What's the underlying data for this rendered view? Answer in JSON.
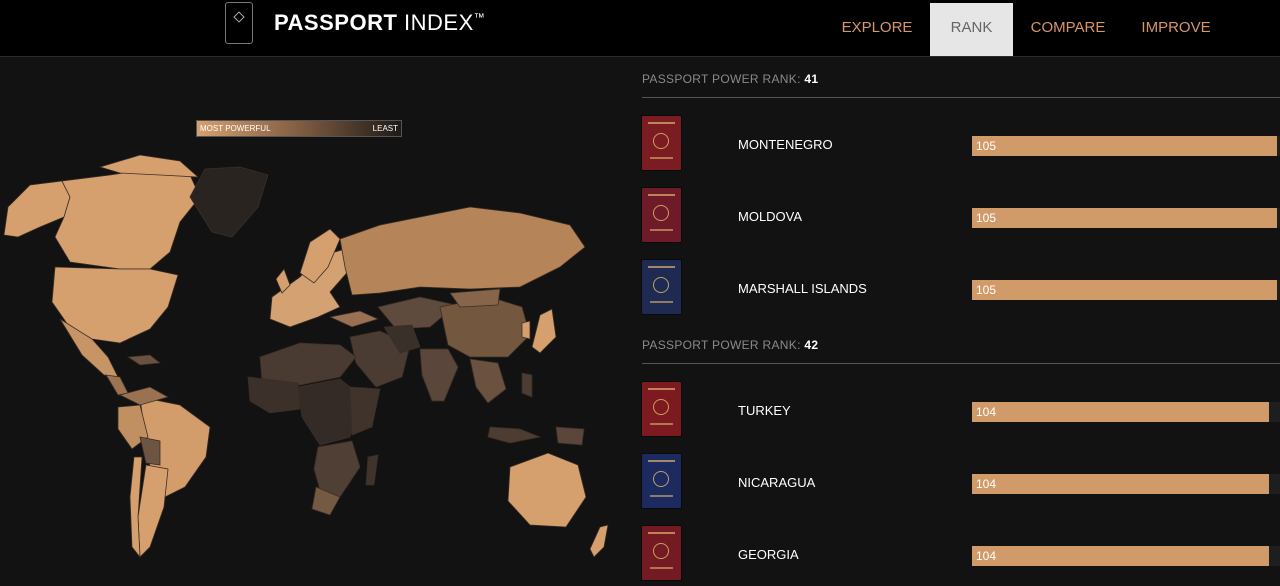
{
  "header": {
    "logo_bold": "PASSPORT",
    "logo_light": "INDEX",
    "logo_tm": "™",
    "nav": [
      {
        "label": "EXPLORE",
        "active": false
      },
      {
        "label": "RANK",
        "active": true
      },
      {
        "label": "COMPARE",
        "active": false
      },
      {
        "label": "IMPROVE",
        "active": false
      }
    ]
  },
  "legend": {
    "left_label": "MOST POWERFUL",
    "right_label": "LEAST"
  },
  "ranks": [
    {
      "label": "PASSPORT POWER RANK:",
      "rank": "41",
      "countries": [
        {
          "name": "MONTENEGRO",
          "score": "105",
          "fill": 0.99,
          "cover_color": "#7a1c22"
        },
        {
          "name": "MOLDOVA",
          "score": "105",
          "fill": 0.99,
          "cover_color": "#6e1a28"
        },
        {
          "name": "MARSHALL ISLANDS",
          "score": "105",
          "fill": 0.99,
          "cover_color": "#1f2a52"
        }
      ]
    },
    {
      "label": "PASSPORT POWER RANK:",
      "rank": "42",
      "countries": [
        {
          "name": "TURKEY",
          "score": "104",
          "fill": 0.965,
          "cover_color": "#7c1a1f"
        },
        {
          "name": "NICARAGUA",
          "score": "104",
          "fill": 0.965,
          "cover_color": "#1d2a60"
        },
        {
          "name": "GEORGIA",
          "score": "104",
          "fill": 0.965,
          "cover_color": "#731a22"
        }
      ]
    }
  ],
  "colors": {
    "accent": "#d5976a",
    "bar": "#d09a69",
    "bg": "#121212",
    "map_strong": "#d6a06e",
    "map_weak": "#2b2522"
  }
}
